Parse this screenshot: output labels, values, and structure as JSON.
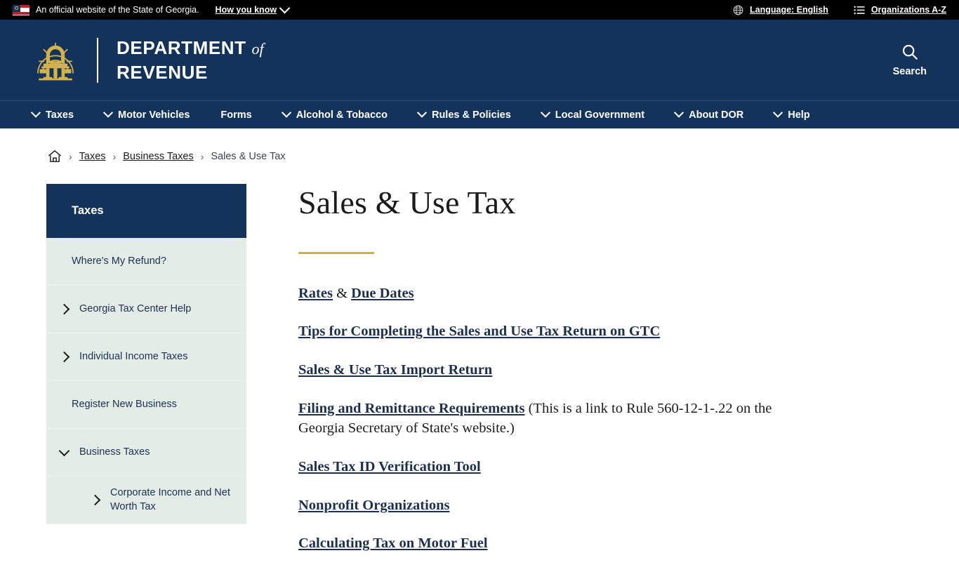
{
  "topbar": {
    "flag_icon": "georgia-flag-icon",
    "official_text": "An official website of the State of Georgia.",
    "how_you_know": "How you know",
    "language_icon": "globe-icon",
    "language": "Language: English",
    "orgs_icon": "list-icon",
    "organizations": "Organizations A-Z"
  },
  "masthead": {
    "emblem_icon": "georgia-arch-emblem-icon",
    "title_line1": "DEPARTMENT",
    "title_of": "of",
    "title_line2": "REVENUE",
    "search_icon": "search-icon",
    "search_label": "Search"
  },
  "nav": {
    "items": [
      {
        "label": "Taxes",
        "has_dropdown": true
      },
      {
        "label": "Motor Vehicles",
        "has_dropdown": true
      },
      {
        "label": "Forms",
        "has_dropdown": false
      },
      {
        "label": "Alcohol & Tobacco",
        "has_dropdown": true
      },
      {
        "label": "Rules & Policies",
        "has_dropdown": true
      },
      {
        "label": "Local Government",
        "has_dropdown": true
      },
      {
        "label": "About DOR",
        "has_dropdown": true
      },
      {
        "label": "Help",
        "has_dropdown": true
      }
    ]
  },
  "breadcrumb": {
    "home_icon": "home-icon",
    "separator": "›",
    "items": [
      {
        "label": "Taxes",
        "link": true
      },
      {
        "label": "Business Taxes",
        "link": true
      },
      {
        "label": "Sales & Use Tax",
        "link": false
      }
    ]
  },
  "sidebar": {
    "heading": "Taxes",
    "items": [
      {
        "label": "Where's My Refund?",
        "arrow": "none",
        "level": 1
      },
      {
        "label": "Georgia Tax Center Help",
        "arrow": "right",
        "level": 1
      },
      {
        "label": "Individual Income Taxes",
        "arrow": "right",
        "level": 1
      },
      {
        "label": "Register New Business",
        "arrow": "none",
        "level": 1
      },
      {
        "label": "Business Taxes",
        "arrow": "down",
        "level": 1
      },
      {
        "label": "Corporate Income and Net Worth Tax",
        "arrow": "right",
        "level": 2
      }
    ]
  },
  "main": {
    "title": "Sales & Use Tax",
    "links": [
      {
        "parts": [
          {
            "text": "Rates",
            "type": "link"
          },
          {
            "text": " & ",
            "type": "text"
          },
          {
            "text": "Due Dates",
            "type": "link"
          }
        ]
      },
      {
        "parts": [
          {
            "text": "Tips for Completing the Sales and Use Tax Return on GTC",
            "type": "link"
          }
        ]
      },
      {
        "parts": [
          {
            "text": "Sales & Use Tax Import Return",
            "type": "link"
          }
        ]
      },
      {
        "parts": [
          {
            "text": "Filing and Remittance Requirements",
            "type": "link"
          },
          {
            "text": " (This is a link to Rule 560-12-1-.22 on the Georgia Secretary of State's website.)",
            "type": "text"
          }
        ]
      },
      {
        "parts": [
          {
            "text": "Sales Tax ID Verification Tool",
            "type": "link"
          }
        ]
      },
      {
        "parts": [
          {
            "text": "Nonprofit Organizations",
            "type": "link"
          }
        ]
      },
      {
        "parts": [
          {
            "text": "Calculating Tax on Motor Fuel",
            "type": "link"
          }
        ]
      }
    ]
  },
  "colors": {
    "navy": "#13335b",
    "gold": "#c5b358",
    "sidebar_bg": "#e3ece6",
    "topbar_bg": "#000000",
    "link_navy": "#1d3050"
  }
}
